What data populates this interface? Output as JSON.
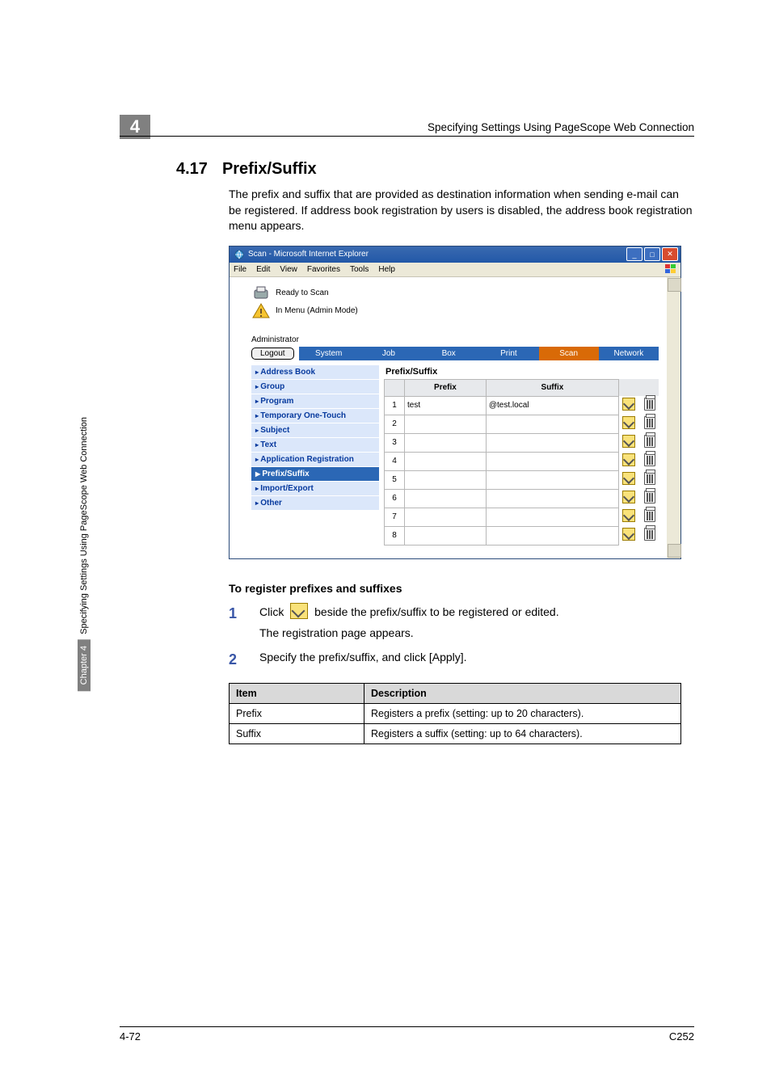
{
  "header": {
    "running": "Specifying Settings Using PageScope Web Connection",
    "chapter_badge": "4"
  },
  "section": {
    "number": "4.17",
    "title": "Prefix/Suffix",
    "intro": "The prefix and suffix that are provided as destination information when sending e-mail can be registered. If address book registration by users is disabled, the address book registration menu appears."
  },
  "screenshot": {
    "title": "Scan - Microsoft Internet Explorer",
    "menus": [
      "File",
      "Edit",
      "View",
      "Favorites",
      "Tools",
      "Help"
    ],
    "status1": "Ready to Scan",
    "status2": "In Menu (Admin Mode)",
    "admin": "Administrator",
    "logout": "Logout",
    "topnav": [
      "System",
      "Job",
      "Box",
      "Print",
      "Scan",
      "Network"
    ],
    "sidebar": [
      "Address Book",
      "Group",
      "Program",
      "Temporary One-Touch",
      "Subject",
      "Text",
      "Application Registration",
      "Prefix/Suffix",
      "Import/Export",
      "Other"
    ],
    "sidebar_active_index": 7,
    "pane_title": "Prefix/Suffix",
    "table": {
      "headers": [
        "",
        "Prefix",
        "Suffix"
      ],
      "rows": [
        {
          "n": "1",
          "prefix": "test",
          "suffix": "@test.local"
        },
        {
          "n": "2",
          "prefix": "",
          "suffix": ""
        },
        {
          "n": "3",
          "prefix": "",
          "suffix": ""
        },
        {
          "n": "4",
          "prefix": "",
          "suffix": ""
        },
        {
          "n": "5",
          "prefix": "",
          "suffix": ""
        },
        {
          "n": "6",
          "prefix": "",
          "suffix": ""
        },
        {
          "n": "7",
          "prefix": "",
          "suffix": ""
        },
        {
          "n": "8",
          "prefix": "",
          "suffix": ""
        }
      ]
    }
  },
  "procedure": {
    "heading": "To register prefixes and suffixes",
    "step1a": "Click ",
    "step1b": " beside the prefix/suffix to be registered or edited.",
    "step1sub": "The registration page appears.",
    "step2": "Specify the prefix/suffix, and click [Apply]."
  },
  "desctable": {
    "head_item": "Item",
    "head_desc": "Description",
    "rows": [
      {
        "item": "Prefix",
        "desc": "Registers a prefix (setting: up to 20 characters)."
      },
      {
        "item": "Suffix",
        "desc": "Registers a suffix (setting: up to 64 characters)."
      }
    ]
  },
  "side": {
    "block": "Chapter 4",
    "rest": "Specifying Settings Using PageScope Web Connection"
  },
  "footer": {
    "left": "4-72",
    "right": "C252"
  }
}
